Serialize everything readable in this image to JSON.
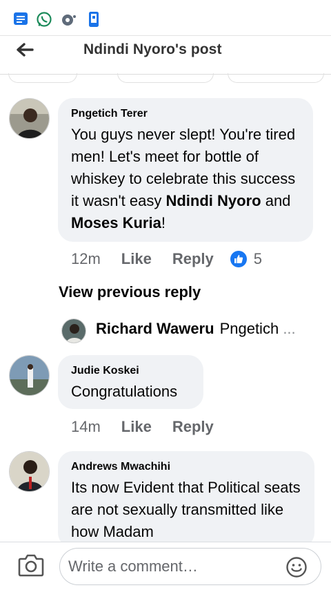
{
  "header": {
    "title": "Ndindi Nyoro's post"
  },
  "status_bar": {
    "icons": [
      "message-icon",
      "whatsapp-icon",
      "chat-icon",
      "phone-icon"
    ]
  },
  "comments": [
    {
      "author": "Pngetich Terer",
      "text_before": "You guys never slept! You're tired men! Let's meet for bottle of whiskey to celebrate this success it wasn't easy ",
      "mention1": "Ndindi Nyoro",
      "text_mid": " and ",
      "mention2": "Moses Kuria",
      "text_after": "!",
      "time": "12m",
      "like_label": "Like",
      "reply_label": "Reply",
      "reaction_count": "5"
    },
    {
      "author": "Judie Koskei",
      "text": "Congratulations",
      "time": "14m",
      "like_label": "Like",
      "reply_label": "Reply"
    },
    {
      "author": "Andrews Mwachihi",
      "text": "Its now Evident that Political seats are not sexually transmitted like how Madam"
    }
  ],
  "view_previous": "View previous reply",
  "reply_preview": {
    "author": "Richard Waweru",
    "snippet": "Pngetich",
    "ellipsis": "..."
  },
  "composer": {
    "placeholder": "Write a comment…"
  },
  "colors": {
    "accent": "#1877f2",
    "bubble": "#f0f2f5",
    "muted": "#65676b"
  }
}
